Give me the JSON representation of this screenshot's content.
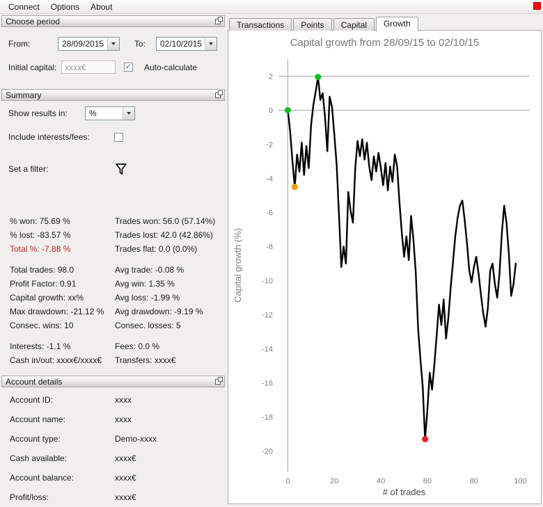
{
  "menu": {
    "items": [
      "Connect",
      "Options",
      "About"
    ]
  },
  "status_indicator_color": "#f90007",
  "choose_period": {
    "title": "Choose period",
    "from_label": "From:",
    "from_value": "28/09/2015",
    "to_label": "To:",
    "to_value": "02/10/2015",
    "initial_capital_label": "Initial capital:",
    "initial_capital_placeholder": "xxxx€",
    "auto_calculate_label": "Auto-calculate",
    "auto_calculate_checked": true
  },
  "summary": {
    "title": "Summary",
    "show_results_label": "Show results in:",
    "show_results_value": "%",
    "include_label": "Include interests/fees:",
    "include_checked": false,
    "filter_label": "Set a filter:",
    "stats": [
      {
        "left": "% won: 75.69 %",
        "right": "Trades won: 56.0 (57.14%)"
      },
      {
        "left": "% lost: -83.57 %",
        "right": "Trades lost: 42.0 (42.86%)"
      },
      {
        "left": "Total %: -7.88 %",
        "right": "Trades flat: 0.0 (0.0%)",
        "left_color": "#cc2222"
      },
      {
        "gap": true
      },
      {
        "left": "Total trades: 98.0",
        "right": "Avg trade: -0.08 %"
      },
      {
        "left": "Profit Factor: 0.91",
        "right": "Avg win: 1.35 %"
      },
      {
        "left": "Capital growth: xx%",
        "right": "Avg loss: -1.99 %"
      },
      {
        "left": "Max drawdown: -21.12 %",
        "right": "Avg drawdown: -9.19 %"
      },
      {
        "left": "Consec. wins: 10",
        "right": "Consec. losses: 5"
      },
      {
        "gap": true
      },
      {
        "left": "Interests: -1.1 %",
        "right": "Fees: 0.0 %"
      },
      {
        "left": "Cash in/out: xxxx€/xxxx€",
        "right": "Transfers: xxxx€"
      }
    ]
  },
  "account": {
    "title": "Account details",
    "rows": [
      {
        "label": "Account ID:",
        "value": "xxxx"
      },
      {
        "label": "Account name:",
        "value": "xxxx"
      },
      {
        "label": "Account type:",
        "value": "Demo-xxxx"
      },
      {
        "label": "Cash available:",
        "value": "xxxx€"
      },
      {
        "label": "Account balance:",
        "value": "xxxx€"
      },
      {
        "label": "Profit/loss:",
        "value": "xxxx€"
      }
    ]
  },
  "tabs": {
    "items": [
      "Transactions",
      "Points",
      "Capital",
      "Growth"
    ],
    "active": "Growth"
  },
  "chart_data": {
    "type": "line",
    "title": "Capital growth from 28/09/15 to 02/10/15",
    "xlabel": "# of trades",
    "ylabel": "Capital growth (%)",
    "xlim": [
      -4,
      104
    ],
    "ylim": [
      -21.2,
      3
    ],
    "x_ticks": [
      0,
      20,
      40,
      60,
      80,
      100
    ],
    "y_ticks": [
      2,
      0,
      -2,
      -4,
      -6,
      -8,
      -10,
      -12,
      -14,
      -16,
      -18,
      -20
    ],
    "grid_y": [
      2,
      0
    ],
    "grid_x": [
      0
    ],
    "line_color": "#000000",
    "values": [
      0,
      -1.2,
      -3,
      -4.5,
      -2.6,
      -3.6,
      -1.9,
      -3.8,
      -2.1,
      -3.4,
      -0.9,
      0.3,
      1.1,
      1.95,
      0.6,
      1,
      -0.4,
      -2.4,
      0.8,
      0.2,
      -1.4,
      -3.2,
      -6.1,
      -9.2,
      -8,
      -9,
      -4.8,
      -5.9,
      -6.6,
      -3.4,
      -1.8,
      -2.7,
      -1.7,
      -2.9,
      -1.9,
      -3.3,
      -4.1,
      -2.7,
      -3.6,
      -2.5,
      -3.4,
      -4.4,
      -3.1,
      -4.7,
      -3.3,
      -4.2,
      -2.6,
      -3.3,
      -5.4,
      -7.2,
      -8.6,
      -7.4,
      -8.8,
      -6.2,
      -7.6,
      -9.5,
      -12.8,
      -14.6,
      -16.2,
      -19.3,
      -17.6,
      -15.4,
      -16.4,
      -14.9,
      -13.2,
      -11.4,
      -12.6,
      -11.1,
      -13.4,
      -12.2,
      -10.4,
      -8.9,
      -7.4,
      -6.3,
      -5.6,
      -5.3,
      -6.4,
      -7.8,
      -9.4,
      -10.1,
      -9.2,
      -8.6,
      -9.6,
      -10.8,
      -11.9,
      -12.7,
      -11.6,
      -9.4,
      -9,
      -10.2,
      -11,
      -9.6,
      -7.2,
      -5.6,
      -6.6,
      -8.4,
      -10.9,
      -10.2,
      -9
    ],
    "markers": [
      {
        "x": 0,
        "y": 0,
        "color": "#0fbf1e",
        "meaning": "start"
      },
      {
        "x": 3,
        "y": -4.5,
        "color": "#ff9800",
        "meaning": "early-drawdown"
      },
      {
        "x": 13,
        "y": 1.95,
        "color": "#0fbf1e",
        "meaning": "maximum"
      },
      {
        "x": 59,
        "y": -19.3,
        "color": "#e32222",
        "meaning": "minimum"
      }
    ]
  }
}
